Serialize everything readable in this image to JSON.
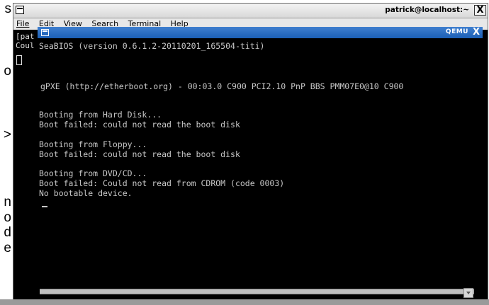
{
  "background_doc": {
    "letters": [
      "s",
      "o",
      ">",
      "n",
      "o",
      "d",
      "e"
    ]
  },
  "terminal": {
    "title": "patrick@localhost:~",
    "close_glyph": "X",
    "menu": [
      "File",
      "Edit",
      "View",
      "Search",
      "Terminal",
      "Help"
    ],
    "lines": [
      "[pat",
      "Coul"
    ]
  },
  "qemu": {
    "title": "QEMU",
    "close_glyph": "X",
    "screen_lines": [
      "SeaBIOS (version 0.6.1.2-20110201_165504-titi)",
      "",
      "",
      "",
      "gPXE (http://etherboot.org) - 00:03.0 C900 PCI2.10 PnP BBS PMM07E0@10 C900",
      "",
      "",
      "Booting from Hard Disk...",
      "Boot failed: could not read the boot disk",
      "",
      "Booting from Floppy...",
      "Boot failed: could not read the boot disk",
      "",
      "Booting from DVD/CD...",
      "Boot failed: Could not read from CDROM (code 0003)",
      "No bootable device."
    ]
  },
  "colors": {
    "qemu_titlebar": "#1b5fb5",
    "screen_bg": "#000000",
    "screen_text": "#c8c8c8"
  }
}
